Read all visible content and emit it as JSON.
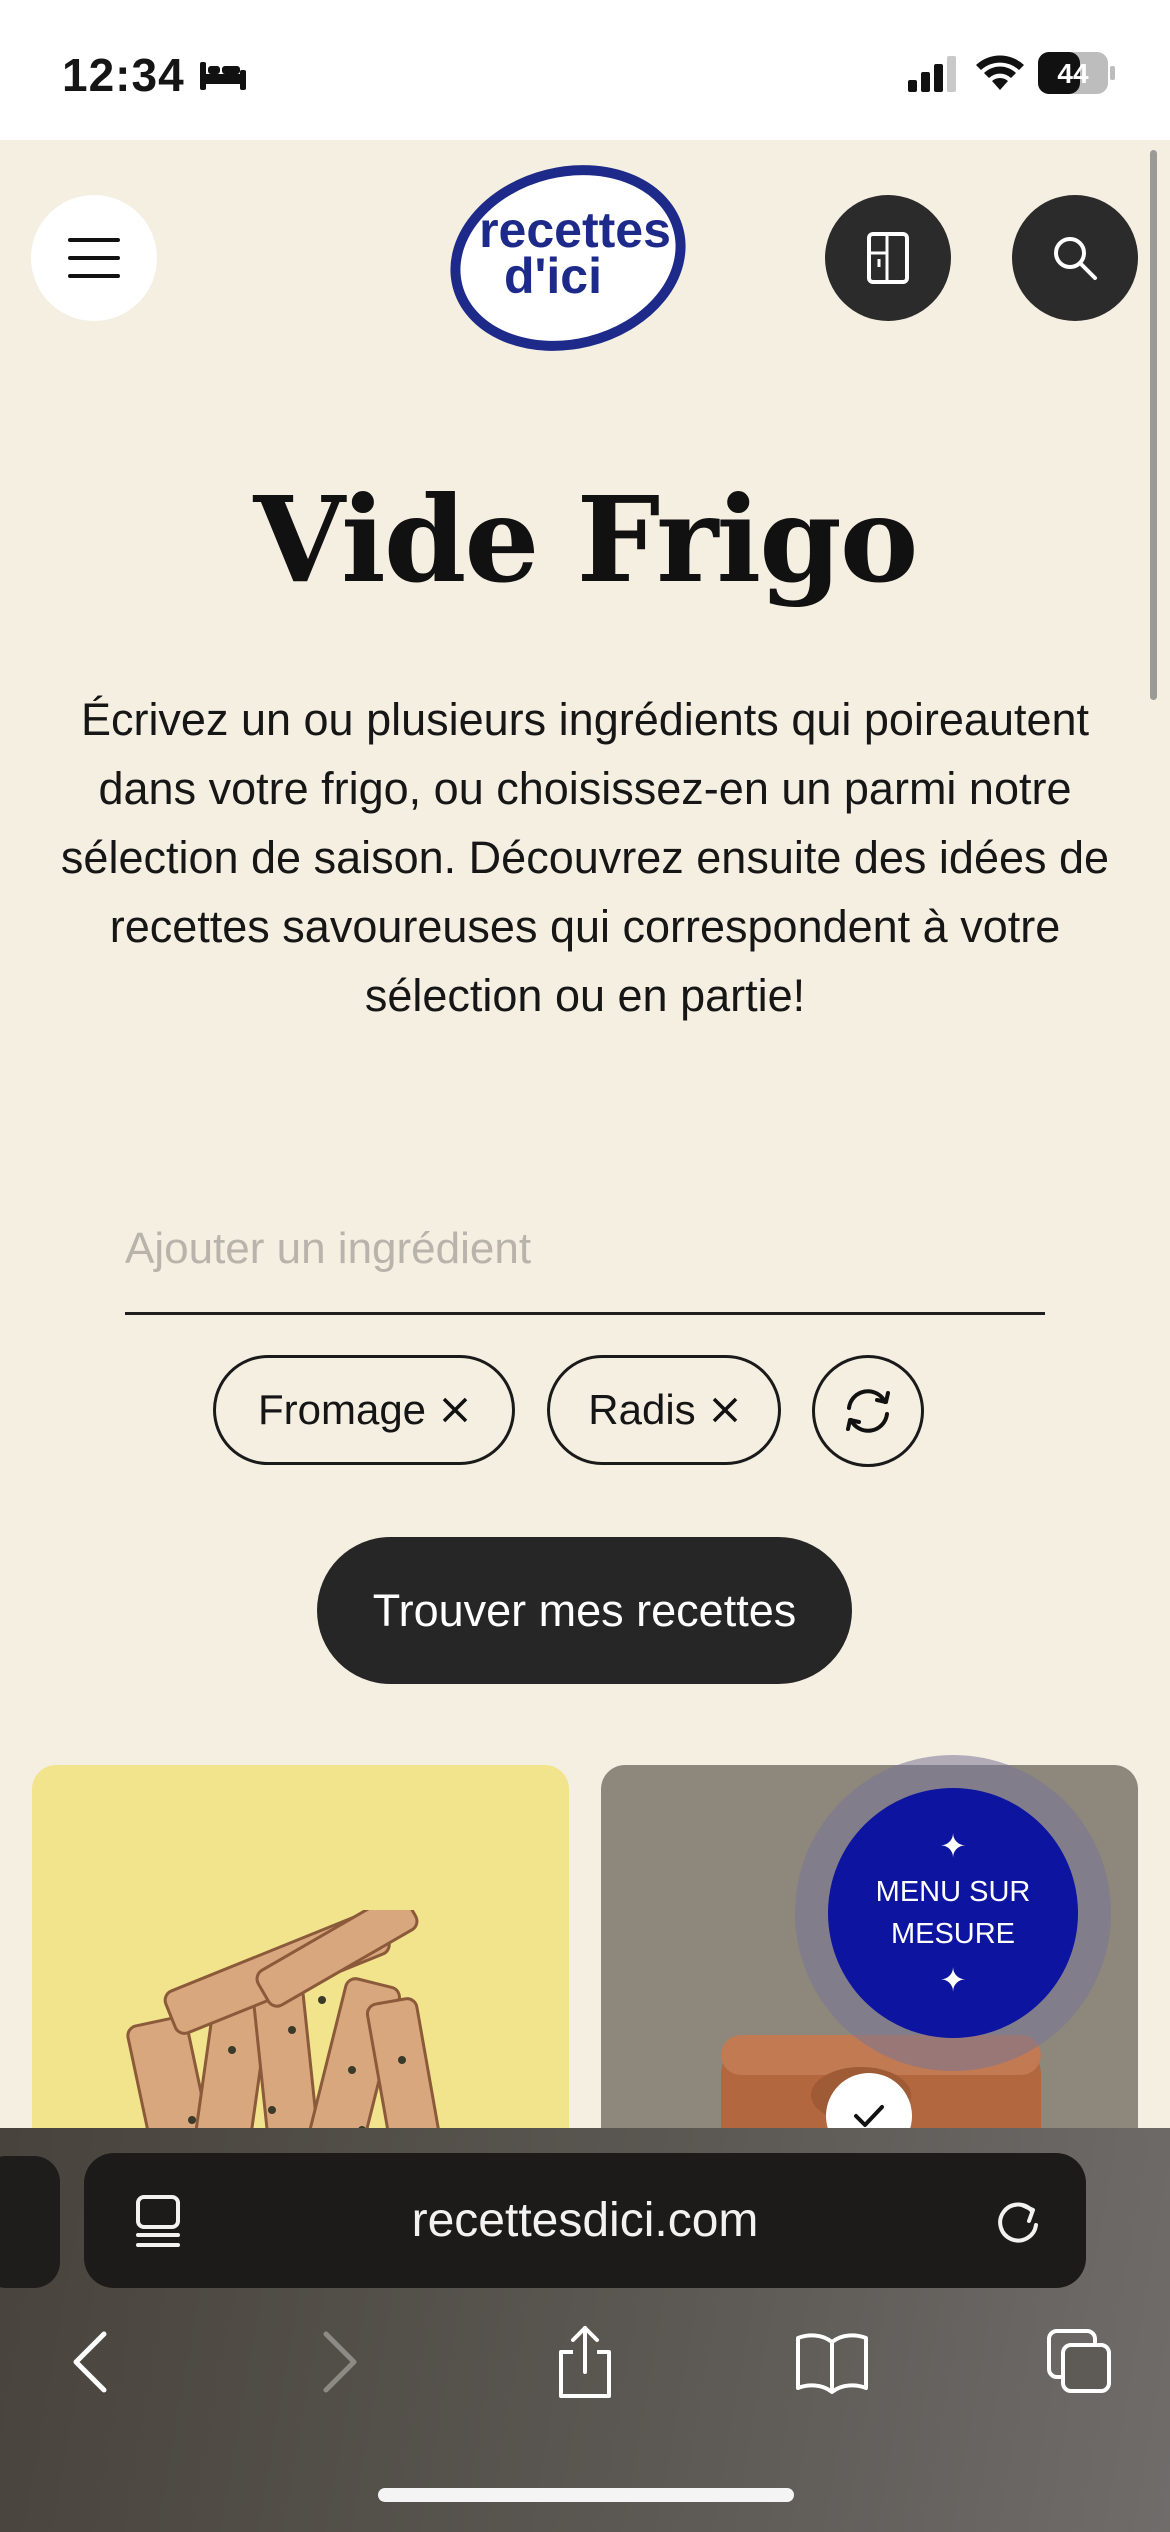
{
  "status_bar": {
    "time": "12:34",
    "focus_icon": "bed-icon",
    "signal_icon": "cellular-signal-icon",
    "wifi_icon": "wifi-icon",
    "battery_level": "44"
  },
  "header": {
    "logo_line1": "recettes",
    "logo_line2": "d'ici",
    "menu_icon": "hamburger-menu-icon",
    "fridge_icon": "fridge-icon",
    "search_icon": "search-icon"
  },
  "hero": {
    "title": "Vide Frigo",
    "description": "Écrivez un ou plusieurs ingrédients qui poireautent dans votre frigo, ou choisissez-en un parmi notre sélection de saison. Découvrez ensuite des idées de recettes savoureuses qui correspondent à votre sélection ou en partie!"
  },
  "ingredient_input": {
    "placeholder": "Ajouter un ingrédient",
    "value": ""
  },
  "selected_ingredients": [
    {
      "label": "Fromage"
    },
    {
      "label": "Radis"
    }
  ],
  "find_button_label": "Trouver mes recettes",
  "menu_fab": {
    "line1": "MENU SUR",
    "line2": "MESURE"
  },
  "browser": {
    "url": "recettesdici.com"
  },
  "colors": {
    "page_background": "#f5efe2",
    "brand_blue": "#1d2a8a",
    "fab_blue": "#0c14a0",
    "dark_button": "#262626",
    "card_yellow": "#f2e48c"
  }
}
